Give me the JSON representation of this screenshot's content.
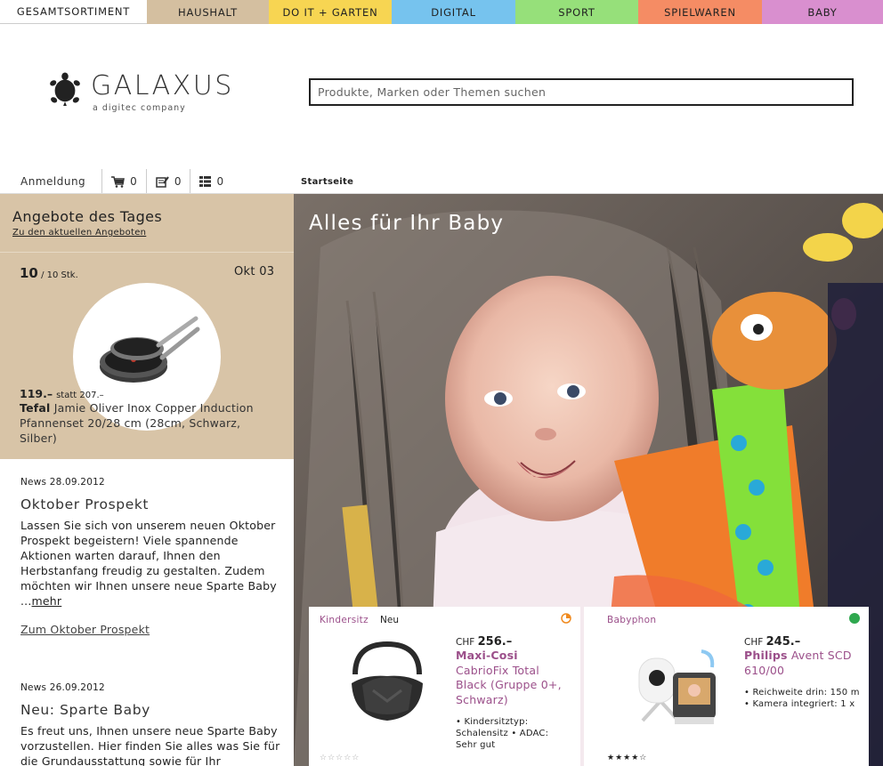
{
  "categories": [
    {
      "label": "GESAMTSORTIMENT",
      "color": "#ffffff"
    },
    {
      "label": "HAUSHALT",
      "color": "#d4bfa0"
    },
    {
      "label": "DO IT + GARTEN",
      "color": "#f7d552"
    },
    {
      "label": "DIGITAL",
      "color": "#76c3ee"
    },
    {
      "label": "SPORT",
      "color": "#96e07a"
    },
    {
      "label": "SPIELWAREN",
      "color": "#f58c64"
    },
    {
      "label": "BABY",
      "color": "#d98fcf"
    }
  ],
  "logo": {
    "name": "GALAXUS",
    "sub": "a digitec company",
    "icon": "turtle-icon"
  },
  "search": {
    "placeholder": "Produkte, Marken oder Themen suchen"
  },
  "userbar": {
    "login": "Anmeldung",
    "cart_count": "0",
    "list_count": "0",
    "compare_count": "0"
  },
  "breadcrumb": "Startseite",
  "deal": {
    "title": "Angebote des Tages",
    "link": "Zu den aktuellen Angeboten",
    "count": "10",
    "count_total": "/ 10 Stk.",
    "date": "Okt 03",
    "price": "119.–",
    "old_price": "statt 207.–",
    "brand": "Tefal",
    "name": "Jamie Oliver Inox Copper Induction Pfannenset 20/28 cm (28cm, Schwarz, Silber)"
  },
  "news": [
    {
      "date": "News 28.09.2012",
      "title": "Oktober Prospekt",
      "text": "Lassen Sie sich von unserem neuen Oktober Prospekt begeistern! Viele spannende Aktionen warten darauf, Ihnen den Herbstanfang freudig zu gestalten. Zudem möchten wir Ihnen unsere neue Sparte Baby ...",
      "more": "mehr",
      "link": "Zum Oktober Prospekt"
    },
    {
      "date": "News 26.09.2012",
      "title": "Neu: Sparte Baby",
      "text": "Es freut uns, Ihnen unsere neue Sparte Baby vorzustellen. Hier finden Sie alles was Sie für die Grundausstattung sowie für Ihr"
    }
  ],
  "hero": {
    "title": "Alles für Ihr Baby"
  },
  "products": [
    {
      "category": "Kindersitz",
      "badge": "Neu",
      "currency": "CHF",
      "price": "256.–",
      "brand": "Maxi-Cosi",
      "name": "CabrioFix Total Black (Gruppe 0+, Schwarz)",
      "features": "• Kindersitztyp: Schalensitz • ADAC: Sehr gut",
      "rating": "☆☆☆☆☆",
      "status_color": "#f08a1e"
    },
    {
      "category": "Babyphon",
      "currency": "CHF",
      "price": "245.–",
      "brand": "Philips",
      "name": "Avent SCD 610/00",
      "features": "• Reichweite drin: 150 m • Kamera integriert: 1 x",
      "rating": "★★★★☆",
      "status_color": "#2fa84f"
    }
  ]
}
